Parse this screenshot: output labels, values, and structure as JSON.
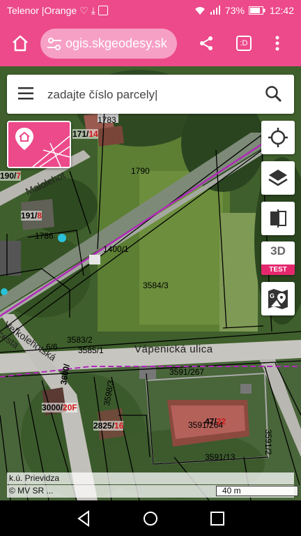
{
  "status_bar": {
    "carrier": "Telenor |Orange",
    "battery": "73%",
    "time": "12:42"
  },
  "browser": {
    "url": "ogis.skgeodesy.sk",
    "tab_label": ":D"
  },
  "search": {
    "placeholder": "zadajte číslo parcely|"
  },
  "map_controls": {
    "three_d": "3D",
    "test_badge": "TEST"
  },
  "map_labels": {
    "p_190_num": "190/",
    "p_190_sub": "7",
    "p_171_num": "171/",
    "p_171_sub": "14",
    "p_191_num": "191/",
    "p_191_sub": "8",
    "p_3000_num": "3000/",
    "p_3000_sub": "20F",
    "p_2825_num": "2825/",
    "p_2825_sub": "16",
    "p_47_num": "47/",
    "p_47_sub": "22",
    "p_1400": "1400/1",
    "p_3584": "3584/3",
    "p_1786": "1786",
    "p_1790": "1790",
    "p_1783": "1783",
    "p_3583": "3583/2",
    "p_3585": "3585/1",
    "p_3591_267": "3591/267",
    "p_3591_264": "3591/264",
    "p_3591_13": "3591/13",
    "p_3591_12": "3591/2",
    "p_3600": "3600/",
    "p_3598": "3598/3",
    "p_6_6": "6/6",
    "street_vapenicka": "Vápenická ulica",
    "street_velkolehotska": "Veľkolehotská cesta",
    "street_malolehotska": "Malolehot"
  },
  "footer": {
    "cadastre": "k.ú. Prievidza",
    "copyright": "© MV SR ...",
    "scale": "40 m"
  },
  "colors": {
    "accent": "#ec4a8b",
    "badge": "#e5286e",
    "parcel_sub": "#d01818"
  }
}
